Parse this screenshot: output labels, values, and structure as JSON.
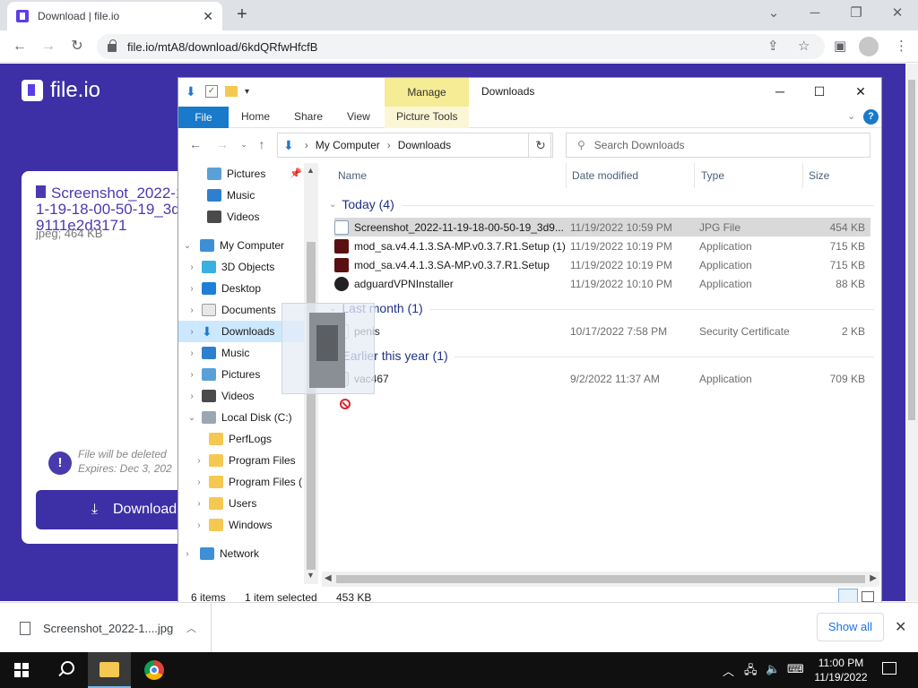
{
  "browser": {
    "tab_title": "Download | file.io",
    "tab_close": "✕",
    "new_tab": "+",
    "url": "file.io/mtA8/download/6kdQRfwHfcfB",
    "window_controls": {
      "minimize": "─",
      "restore": "❐",
      "close": "✕",
      "tab_search": "⌄"
    }
  },
  "page": {
    "logo_text": "file.io",
    "file_name": "Screenshot_2022-11-19-18-00-50-19_3d9111e2d3171",
    "file_meta": "jpeg; 464 KB",
    "warning_line1": "File will be deleted",
    "warning_line2": "Expires: Dec 3, 202",
    "download_button": "Download",
    "colors": {
      "brand": "#3d2fa6",
      "brand_text": "#4a3ab0"
    }
  },
  "explorer": {
    "title": "Downloads",
    "manage_tab": "Manage",
    "ribbon_tabs": [
      "File",
      "Home",
      "Share",
      "View",
      "Picture Tools"
    ],
    "breadcrumb": [
      "My Computer",
      "Downloads"
    ],
    "search_placeholder": "Search Downloads",
    "nav_tree": [
      {
        "label": "Pictures",
        "icon": "pictures-icon",
        "pinned": true
      },
      {
        "label": "Music",
        "icon": "music-icon"
      },
      {
        "label": "Videos",
        "icon": "videos-icon"
      },
      {
        "label": "My Computer",
        "icon": "computer-icon",
        "expanded": true
      },
      {
        "label": "3D Objects",
        "icon": "3d-objects-icon"
      },
      {
        "label": "Desktop",
        "icon": "desktop-icon"
      },
      {
        "label": "Documents",
        "icon": "documents-icon"
      },
      {
        "label": "Downloads",
        "icon": "downloads-icon",
        "selected": true
      },
      {
        "label": "Music",
        "icon": "music-icon"
      },
      {
        "label": "Pictures",
        "icon": "pictures-icon"
      },
      {
        "label": "Videos",
        "icon": "videos-icon"
      },
      {
        "label": "Local Disk (C:)",
        "icon": "drive-icon",
        "expanded": true
      },
      {
        "label": "PerfLogs",
        "icon": "folder-icon"
      },
      {
        "label": "Program Files",
        "icon": "folder-icon"
      },
      {
        "label": "Program Files (",
        "icon": "folder-icon"
      },
      {
        "label": "Users",
        "icon": "folder-icon"
      },
      {
        "label": "Windows",
        "icon": "folder-icon"
      },
      {
        "label": "Network",
        "icon": "network-icon"
      }
    ],
    "columns": [
      "Name",
      "Date modified",
      "Type",
      "Size"
    ],
    "groups": [
      {
        "label": "Today (4)",
        "files": [
          {
            "name": "Screenshot_2022-11-19-18-00-50-19_3d9...",
            "date": "11/19/2022 10:59 PM",
            "type": "JPG File",
            "size": "454 KB",
            "icon": "jpg-file-icon",
            "selected": true
          },
          {
            "name": "mod_sa.v4.4.1.3.SA-MP.v0.3.7.R1.Setup (1)",
            "date": "11/19/2022 10:19 PM",
            "type": "Application",
            "size": "715 KB",
            "icon": "app-icon"
          },
          {
            "name": "mod_sa.v4.4.1.3.SA-MP.v0.3.7.R1.Setup",
            "date": "11/19/2022 10:19 PM",
            "type": "Application",
            "size": "715 KB",
            "icon": "app-icon"
          },
          {
            "name": "adguardVPNInstaller",
            "date": "11/19/2022 10:10 PM",
            "type": "Application",
            "size": "88 KB",
            "icon": "adguard-icon"
          }
        ]
      },
      {
        "label": "Last month (1)",
        "files": [
          {
            "name": "penis",
            "date": "10/17/2022 7:58 PM",
            "type": "Security Certificate",
            "size": "2 KB",
            "icon": "certificate-icon"
          }
        ]
      },
      {
        "label": "Earlier this year (1)",
        "files": [
          {
            "name": "vac467",
            "date": "9/2/2022 11:37 AM",
            "type": "Application",
            "size": "709 KB",
            "icon": "app-icon"
          }
        ]
      }
    ],
    "status": {
      "items": "6 items",
      "selected": "1 item selected",
      "size": "453 KB"
    }
  },
  "download_bar": {
    "item_name": "Screenshot_2022-1....jpg",
    "show_all": "Show all"
  },
  "taskbar": {
    "time": "11:00 PM",
    "date": "11/19/2022"
  }
}
